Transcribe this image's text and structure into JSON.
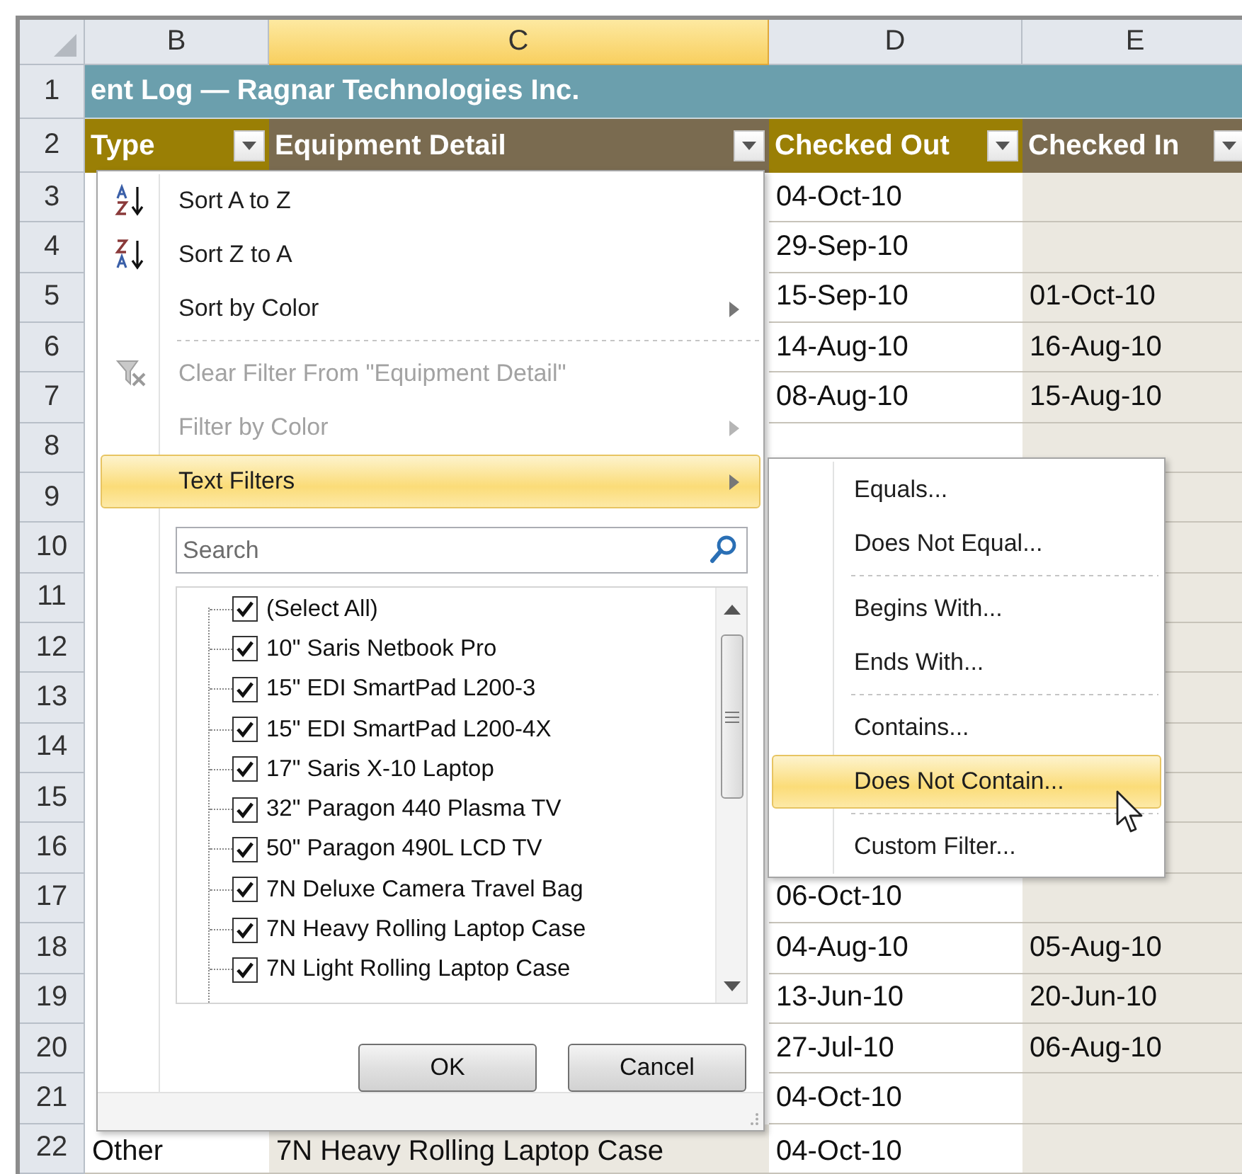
{
  "column_headers": [
    {
      "label": "B",
      "selected": false
    },
    {
      "label": "C",
      "selected": true
    },
    {
      "label": "D",
      "selected": false
    },
    {
      "label": "E",
      "selected": false
    }
  ],
  "rows": [
    {
      "number": "1",
      "kind": "title",
      "title": "ent Log — Ragnar Technologies Inc."
    },
    {
      "number": "2",
      "kind": "header",
      "cells": [
        {
          "label": "Type"
        },
        {
          "label": "Equipment Detail"
        },
        {
          "label": "Checked Out"
        },
        {
          "label": "Checked In"
        }
      ]
    },
    {
      "number": "3",
      "kind": "data",
      "cells": {
        "d": "04-Oct-10"
      }
    },
    {
      "number": "4",
      "kind": "data",
      "cells": {
        "d": "29-Sep-10"
      }
    },
    {
      "number": "5",
      "kind": "data",
      "cells": {
        "d": "15-Sep-10",
        "e": "01-Oct-10"
      }
    },
    {
      "number": "6",
      "kind": "data",
      "cells": {
        "d": "14-Aug-10",
        "e": "16-Aug-10"
      }
    },
    {
      "number": "7",
      "kind": "data",
      "cells": {
        "d": "08-Aug-10",
        "e": "15-Aug-10"
      }
    },
    {
      "number": "8",
      "kind": "data",
      "cells": {}
    },
    {
      "number": "9",
      "kind": "data",
      "cells": {}
    },
    {
      "number": "10",
      "kind": "data",
      "cells": {}
    },
    {
      "number": "11",
      "kind": "data",
      "cells": {}
    },
    {
      "number": "12",
      "kind": "data",
      "cells": {}
    },
    {
      "number": "13",
      "kind": "data",
      "cells": {}
    },
    {
      "number": "14",
      "kind": "data",
      "cells": {}
    },
    {
      "number": "15",
      "kind": "data",
      "cells": {}
    },
    {
      "number": "16",
      "kind": "data",
      "cells": {}
    },
    {
      "number": "17",
      "kind": "data",
      "cells": {
        "d": "06-Oct-10"
      }
    },
    {
      "number": "18",
      "kind": "data",
      "cells": {
        "d": "04-Aug-10",
        "e": "05-Aug-10"
      }
    },
    {
      "number": "19",
      "kind": "data",
      "cells": {
        "d": "13-Jun-10",
        "e": "20-Jun-10"
      }
    },
    {
      "number": "20",
      "kind": "data",
      "cells": {
        "d": "27-Jul-10",
        "e": "06-Aug-10"
      }
    },
    {
      "number": "21",
      "kind": "data",
      "cells": {
        "d": "04-Oct-10"
      }
    },
    {
      "number": "22",
      "kind": "data",
      "cells": {
        "b": "Other",
        "c": "7N Heavy Rolling Laptop Case",
        "d": "04-Oct-10"
      }
    }
  ],
  "filter_menu": {
    "items": [
      {
        "kind": "sort_ascending",
        "label": "Sort A to Z",
        "disabled": false,
        "submenu": false,
        "selected": false
      },
      {
        "kind": "sort_descending",
        "label": "Sort Z to A",
        "disabled": false,
        "submenu": false,
        "selected": false
      },
      {
        "kind": "command",
        "label": "Sort by Color",
        "disabled": false,
        "submenu": true,
        "selected": false
      },
      {
        "kind": "separator"
      },
      {
        "kind": "clear_filter",
        "label": "Clear Filter From \"Equipment Detail\"",
        "disabled": true,
        "submenu": false,
        "selected": false
      },
      {
        "kind": "command",
        "label": "Filter by Color",
        "disabled": true,
        "submenu": true,
        "selected": false
      },
      {
        "kind": "command",
        "label": "Text Filters",
        "disabled": false,
        "submenu": true,
        "selected": true
      }
    ],
    "search": {
      "placeholder": "Search"
    },
    "values": [
      {
        "label": "(Select All)",
        "checked": true
      },
      {
        "label": "10\" Saris Netbook Pro",
        "checked": true
      },
      {
        "label": "15\" EDI SmartPad L200-3",
        "checked": true
      },
      {
        "label": "15\" EDI SmartPad L200-4X",
        "checked": true
      },
      {
        "label": "17\" Saris X-10 Laptop",
        "checked": true
      },
      {
        "label": "32\" Paragon 440 Plasma TV",
        "checked": true
      },
      {
        "label": "50\" Paragon 490L LCD TV",
        "checked": true
      },
      {
        "label": "7N Deluxe Camera Travel Bag",
        "checked": true
      },
      {
        "label": "7N Heavy Rolling Laptop Case",
        "checked": true
      },
      {
        "label": "7N Light Rolling Laptop Case",
        "checked": true
      }
    ],
    "buttons": [
      "OK",
      "Cancel"
    ]
  },
  "text_filters_menu": {
    "items": [
      {
        "kind": "command",
        "label": "Equals...",
        "selected": false
      },
      {
        "kind": "command",
        "label": "Does Not Equal...",
        "selected": false
      },
      {
        "kind": "separator"
      },
      {
        "kind": "command",
        "label": "Begins With...",
        "selected": false
      },
      {
        "kind": "command",
        "label": "Ends With...",
        "selected": false
      },
      {
        "kind": "separator"
      },
      {
        "kind": "command",
        "label": "Contains...",
        "selected": false
      },
      {
        "kind": "command",
        "label": "Does Not Contain...",
        "selected": true
      },
      {
        "kind": "separator"
      },
      {
        "kind": "command",
        "label": "Custom Filter...",
        "selected": false
      }
    ]
  }
}
